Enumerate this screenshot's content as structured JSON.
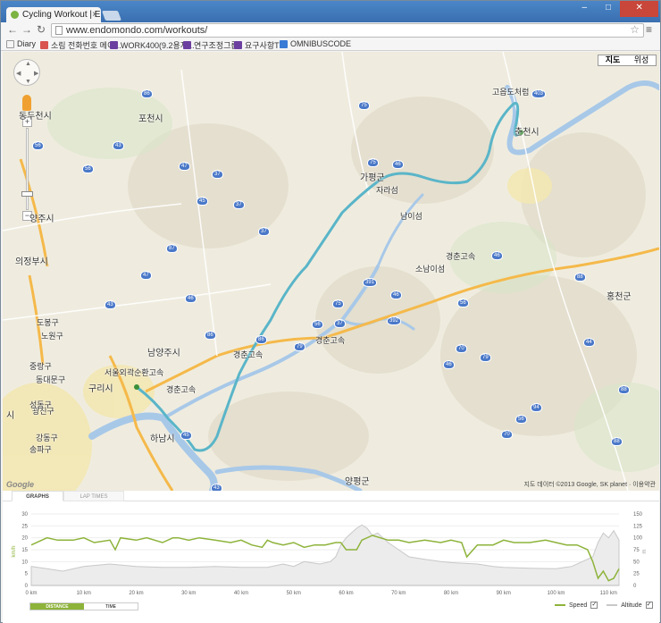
{
  "browser": {
    "tab_title": "Cycling Workout | Endo",
    "tab_close": "×",
    "url": "www.endomondo.com/workouts/",
    "nav_back": "←",
    "nav_forward": "→",
    "nav_reload": "↻",
    "star": "☆",
    "menu": "≡",
    "win_min": "–",
    "win_max": "□",
    "win_close": "✕"
  },
  "bookmarks": [
    {
      "label": "Diary",
      "color": "#f5f5f5"
    },
    {
      "label": "소림 전화번호 메이...",
      "color": "#d9534f"
    },
    {
      "label": "WORK400(9.2용지...",
      "color": "#6b3fa0"
    },
    {
      "label": "연구조정그룹",
      "color": "#6b3fa0"
    },
    {
      "label": "요구사항TF",
      "color": "#6b3fa0"
    },
    {
      "label": "OMNIBUSCODE",
      "color": "#3a7bd5"
    }
  ],
  "map": {
    "toggle": [
      "지도",
      "위성"
    ],
    "pan_arrows": [
      "▲",
      "◀",
      "▶",
      "▼"
    ],
    "zoom_in": "+",
    "zoom_out": "−",
    "logo": "Google",
    "copyright": "지도 데이터 ©2013 Google, SK planet · 이용약관",
    "labels": [
      {
        "text": "동두천시",
        "big": true
      },
      {
        "text": "포천시",
        "big": true
      },
      {
        "text": "양주시",
        "big": true
      },
      {
        "text": "의정부시",
        "big": true
      },
      {
        "text": "가평군",
        "big": true
      },
      {
        "text": "춘천시",
        "big": true
      },
      {
        "text": "홍천군",
        "big": true
      },
      {
        "text": "남양주시",
        "big": true
      },
      {
        "text": "구리시",
        "big": true
      },
      {
        "text": "하남시",
        "big": true
      },
      {
        "text": "양평군",
        "big": true
      },
      {
        "text": "고읍도처럼",
        "big": false
      },
      {
        "text": "소남이섬",
        "big": false
      },
      {
        "text": "남이섬",
        "big": false
      },
      {
        "text": "자라섬",
        "big": false
      },
      {
        "text": "경춘고속",
        "big": false
      },
      {
        "text": "경춘고속",
        "big": false
      },
      {
        "text": "경춘고속",
        "big": false
      },
      {
        "text": "경춘고속",
        "big": false
      },
      {
        "text": "서울외곽순환고속",
        "big": false
      },
      {
        "text": "도봉구",
        "big": false
      },
      {
        "text": "노원구",
        "big": false
      },
      {
        "text": "중랑구",
        "big": false
      },
      {
        "text": "광진구",
        "big": false
      },
      {
        "text": "강동구",
        "big": false
      },
      {
        "text": "송파구",
        "big": false
      },
      {
        "text": "성동구",
        "big": false
      },
      {
        "text": "동대문구",
        "big": false
      },
      {
        "text": "시",
        "big": true
      }
    ],
    "road_shields": [
      "75",
      "403",
      "56",
      "46",
      "75",
      "37",
      "86",
      "43",
      "56",
      "47",
      "37",
      "37",
      "87",
      "45",
      "47",
      "43",
      "46",
      "86",
      "75",
      "37",
      "391",
      "46",
      "56",
      "79",
      "44",
      "46",
      "45",
      "43",
      "86",
      "392",
      "56",
      "70",
      "56",
      "79",
      "70",
      "94",
      "88",
      "88",
      "88",
      "46"
    ]
  },
  "panel": {
    "tab_graphs": "GRAPHS",
    "tab_laptimes": "LAP TIMES",
    "btn_distance": "DISTANCE",
    "btn_time": "TIME",
    "legend_speed": "Speed",
    "legend_altitude": "Altitude",
    "check": "✓"
  },
  "colors": {
    "speed": "#8db33a",
    "altitude": "#c8c8c8",
    "route": "#5ab5c8",
    "river": "#a8c8e8",
    "highway": "#f5b94a"
  },
  "chart_data": {
    "type": "line",
    "xlabel": "",
    "ylabel_left": "km/h",
    "ylabel_right": "m",
    "x_ticks": [
      "0 km",
      "10 km",
      "20 km",
      "30 km",
      "40 km",
      "50 km",
      "60 km",
      "70 km",
      "80 km",
      "90 km",
      "100 km",
      "110 km"
    ],
    "y_left_ticks": [
      "0",
      "5",
      "10",
      "15",
      "20",
      "25",
      "30"
    ],
    "y_right_ticks": [
      "0",
      "25",
      "50",
      "75",
      "100",
      "125",
      "150"
    ],
    "ylim_left": [
      0,
      30
    ],
    "ylim_right": [
      0,
      150
    ],
    "xlim": [
      0,
      112
    ],
    "series": [
      {
        "name": "Speed",
        "axis": "left",
        "x": [
          0,
          3,
          5,
          8,
          10,
          12,
          15,
          16,
          17,
          20,
          22,
          25,
          27,
          28,
          30,
          32,
          35,
          38,
          40,
          42,
          44,
          45,
          46,
          48,
          50,
          52,
          54,
          56,
          58,
          59,
          60,
          62,
          63,
          65,
          68,
          70,
          72,
          75,
          78,
          80,
          82,
          83,
          85,
          88,
          90,
          92,
          95,
          98,
          100,
          102,
          104,
          106,
          107,
          108,
          109,
          110,
          111,
          112
        ],
        "values": [
          17,
          20,
          19,
          19,
          20,
          18,
          19,
          15,
          20,
          19,
          20,
          18,
          20,
          20,
          19,
          20,
          19,
          18,
          19,
          17,
          16,
          19,
          18,
          17,
          18,
          16,
          17,
          17,
          18,
          18,
          15,
          15,
          19,
          21,
          19,
          19,
          18,
          19,
          18,
          19,
          18,
          12,
          17,
          17,
          19,
          18,
          18,
          19,
          18,
          17,
          17,
          15,
          10,
          3,
          6,
          2,
          3,
          7
        ]
      },
      {
        "name": "Altitude",
        "axis": "right",
        "x": [
          0,
          3,
          6,
          10,
          15,
          20,
          25,
          30,
          35,
          40,
          45,
          48,
          50,
          52,
          55,
          57,
          58,
          59,
          60,
          61,
          62,
          63,
          64,
          65,
          66,
          68,
          70,
          72,
          75,
          78,
          80,
          85,
          88,
          90,
          95,
          100,
          103,
          105,
          107,
          108,
          109,
          110,
          111,
          112
        ],
        "values": [
          40,
          35,
          30,
          40,
          45,
          40,
          38,
          38,
          40,
          38,
          38,
          45,
          40,
          50,
          45,
          50,
          60,
          85,
          100,
          110,
          120,
          127,
          120,
          105,
          110,
          90,
          75,
          60,
          55,
          50,
          48,
          45,
          40,
          38,
          36,
          35,
          40,
          50,
          60,
          90,
          110,
          100,
          115,
          95
        ]
      }
    ]
  }
}
